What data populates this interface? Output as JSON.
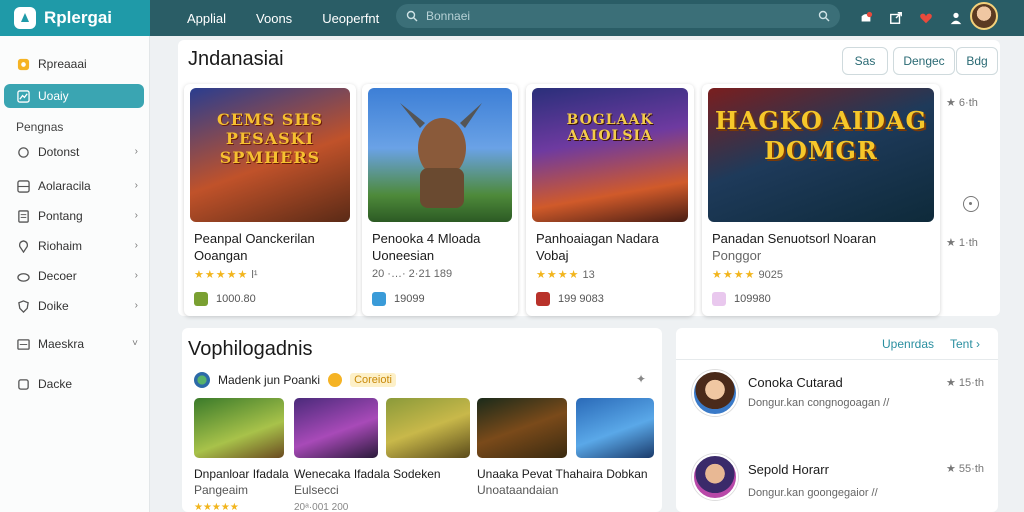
{
  "app": {
    "name": "Rplergai"
  },
  "topnav": {
    "items": [
      "Applial",
      "Voons",
      "Ueoperfnt"
    ]
  },
  "search": {
    "placeholder": "Bonnaei"
  },
  "sidebar": {
    "items": [
      {
        "label": "Rpreaaai",
        "icon": "star-badge-icon"
      },
      {
        "label": "Uoaiy",
        "icon": "chart-icon"
      },
      {
        "label": "Dotonst",
        "icon": "chat-icon"
      },
      {
        "label": "Aolaracila",
        "icon": "grid-icon"
      },
      {
        "label": "Pontang",
        "icon": "document-icon"
      },
      {
        "label": "Riohaim",
        "icon": "location-icon"
      },
      {
        "label": "Decoer",
        "icon": "controller-icon"
      },
      {
        "label": "Doike",
        "icon": "shield-icon"
      },
      {
        "label": "Maeskra",
        "icon": "list-icon"
      },
      {
        "label": "Dacke",
        "icon": "square-icon"
      }
    ],
    "section_label": "Pengnas"
  },
  "featured": {
    "title": "Jndanasiai",
    "tabs": [
      "Sas",
      "Dengec",
      "Bdg"
    ],
    "cards": [
      {
        "art_text": "CEMS SHS PESASKI SPMHERS",
        "title_line1": "Peanpal Oanckerilan",
        "title_line2": "Ooangan",
        "stars": "★★★★★",
        "rating_note": "l¹",
        "meta": "1000.80"
      },
      {
        "art_text": "",
        "title_line1": "Penooka 4 Mloada",
        "title_line2": "Uoneesian",
        "stars": "",
        "rating_note": "20 ·…· 2·21 189",
        "meta": "19099"
      },
      {
        "art_text": "BOGLAAK AAIOLSIA",
        "title_line1": "Panhoaiagan Nadara",
        "title_line2": "Vobaj",
        "stars": "★★★★",
        "rating_note": "13",
        "meta": "199 9083"
      },
      {
        "art_text": "HAGKO AIDAG DOMGR",
        "title_line1": "Panadan Senuotsorl Noaran",
        "title_line2": "Ponggor",
        "stars": "★★★★",
        "rating_note": "9025",
        "meta": "109980"
      }
    ],
    "side_ranks": [
      "★ 6·th",
      "★ 1·th"
    ]
  },
  "recommend": {
    "title": "Vophilogadnis",
    "sub_label": "Madenk jun Poanki",
    "pill": "Coreioti",
    "games": [
      {
        "title": "Dnpanloar Ifadala",
        "sub": "Pangeaim",
        "stars": "★★★★★"
      },
      {
        "title": "Wenecaka Ifadala Sodeken",
        "sub": "Eulsecci",
        "stars": "20ᵃ·001 200"
      },
      {
        "title": "Unaaka Pevat Thahaira Dobkan",
        "sub": "Unoataandaian",
        "stars": ""
      }
    ]
  },
  "friends": {
    "links": [
      "Upenrdas",
      "Tent ›"
    ],
    "people": [
      {
        "name": "Conoka Cutarad",
        "sub": "Dongur.kan congnogoagan //",
        "rank": "★ 15·th"
      },
      {
        "name": "Sepold Horarr",
        "sub": "Dongur.kan goongegaior //",
        "rank": "★ 55·th"
      }
    ]
  },
  "colors": {
    "accent": "#3aa5b2",
    "topbar": "#2a5d66",
    "brand": "#1f9aa8",
    "star": "#f2b51d"
  }
}
